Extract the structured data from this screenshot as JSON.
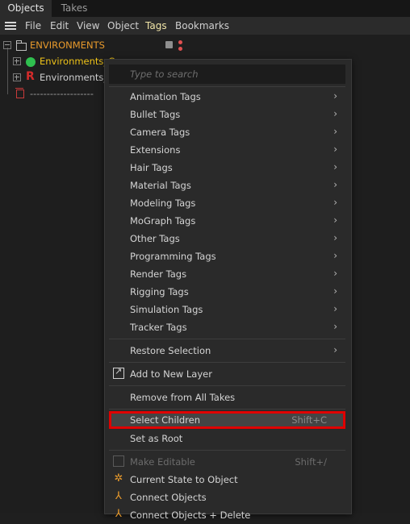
{
  "tabs": [
    {
      "label": "Objects"
    },
    {
      "label": "Takes"
    }
  ],
  "menubar": {
    "items": [
      {
        "label": "File"
      },
      {
        "label": "Edit"
      },
      {
        "label": "View"
      },
      {
        "label": "Object"
      },
      {
        "label": "Tags"
      },
      {
        "label": "Bookmarks"
      }
    ]
  },
  "tree": {
    "rows": [
      {
        "label": "ENVIRONMENTS"
      },
      {
        "label": "Environments_C"
      },
      {
        "label": "Environments_R"
      },
      {
        "label": "-------------------"
      }
    ]
  },
  "context_menu": {
    "search_placeholder": "Type to search",
    "submenus": [
      {
        "label": "Animation Tags"
      },
      {
        "label": "Bullet Tags"
      },
      {
        "label": "Camera Tags"
      },
      {
        "label": "Extensions"
      },
      {
        "label": "Hair Tags"
      },
      {
        "label": "Material Tags"
      },
      {
        "label": "Modeling Tags"
      },
      {
        "label": "MoGraph Tags"
      },
      {
        "label": "Other Tags"
      },
      {
        "label": "Programming Tags"
      },
      {
        "label": "Render Tags"
      },
      {
        "label": "Rigging Tags"
      },
      {
        "label": "Simulation Tags"
      },
      {
        "label": "Tracker Tags"
      }
    ],
    "restore_selection": "Restore Selection",
    "add_to_new_layer": "Add to New Layer",
    "remove_from_all_takes": "Remove from All Takes",
    "select_children": {
      "label": "Select Children",
      "shortcut": "Shift+C"
    },
    "set_as_root": "Set as Root",
    "make_editable": {
      "label": "Make Editable",
      "shortcut": "Shift+/"
    },
    "current_state_to_object": "Current State to Object",
    "connect_objects": "Connect Objects",
    "connect_objects_delete": "Connect Objects + Delete"
  },
  "colors": {
    "accent_orange": "#e89a2c",
    "highlight_red": "#e00000",
    "sphere_green": "#2fbf4f",
    "active_menu": "#f2e6a8"
  }
}
